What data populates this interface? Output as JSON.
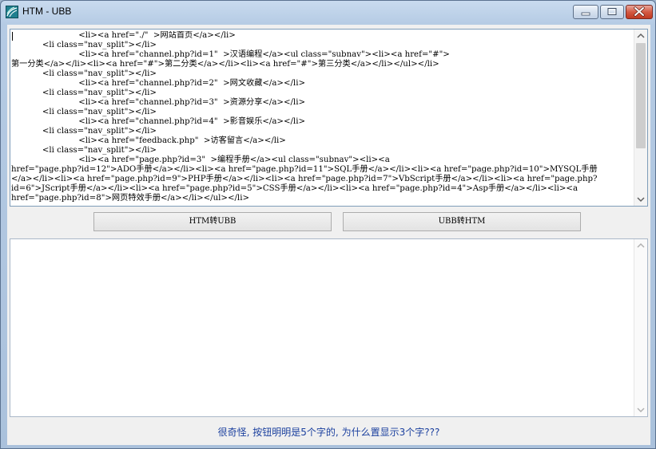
{
  "window": {
    "title": "HTM - UBB",
    "icon": "app-logo-icon",
    "controls": [
      "minimize-icon",
      "maximize-icon",
      "close-icon"
    ]
  },
  "top_editor": {
    "lines": [
      "                          <li><a href=\"./\"  >网站首页</a></li>",
      "            <li class=\"nav_split\"></li>",
      "                          <li><a href=\"channel.php?id=1\"  >汉语编程</a><ul class=\"subnav\"><li><a href=\"#\">",
      "第一分类</a></li><li><a href=\"#\">第二分类</a></li><li><a href=\"#\">第三分类</a></li></ul></li>",
      "            <li class=\"nav_split\"></li>",
      "                          <li><a href=\"channel.php?id=2\"  >网文收藏</a></li>",
      "            <li class=\"nav_split\"></li>",
      "                          <li><a href=\"channel.php?id=3\"  >资源分享</a></li>",
      "            <li class=\"nav_split\"></li>",
      "                          <li><a href=\"channel.php?id=4\"  >影音娱乐</a></li>",
      "            <li class=\"nav_split\"></li>",
      "                          <li><a href=\"feedback.php\"  >访客留言</a></li>",
      "            <li class=\"nav_split\"></li>",
      "                          <li><a href=\"page.php?id=3\"  >编程手册</a><ul class=\"subnav\"><li><a",
      "href=\"page.php?id=12\">ADO手册</a></li><li><a href=\"page.php?id=11\">SQL手册</a></li><li><a href=\"page.php?id=10\">MYSQL手册",
      "</a></li><li><a href=\"page.php?id=9\">PHP手册</a></li><li><a href=\"page.php?id=7\">VbScript手册</a></li><li><a href=\"page.php?",
      "id=6\">JScript手册</a></li><li><a href=\"page.php?id=5\">CSS手册</a></li><li><a href=\"page.php?id=4\">Asp手册</a></li><li><a",
      "href=\"page.php?id=8\">网页特效手册</a></li></ul></li>"
    ]
  },
  "buttons": {
    "htm_to_ubb": "HTM转UBB",
    "ubb_to_htm": "UBB转HTM"
  },
  "bottom_editor": {
    "value": ""
  },
  "status_text": "很奇怪, 按钮明明是5个字的, 为什么置显示3个字???",
  "colors": {
    "status": "#1a3f9e",
    "close_button": "#c13a22"
  }
}
